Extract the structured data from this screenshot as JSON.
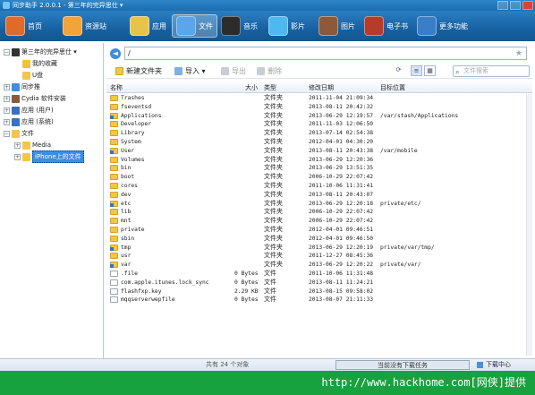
{
  "window": {
    "title": "同步助手 2.0.0.1 - 第三年的完异思仕 ▾"
  },
  "toolbar": {
    "items": [
      {
        "label": "首页",
        "icon": "home-icon",
        "color": "#e06a2a"
      },
      {
        "label": "资源站",
        "icon": "resource-icon",
        "color": "#f2a33a"
      },
      {
        "label": "应用",
        "icon": "apps-icon",
        "color": "#e6c44a"
      },
      {
        "label": "文件",
        "icon": "files-icon",
        "color": "#5aa6e8",
        "active": true
      },
      {
        "label": "音乐",
        "icon": "music-icon",
        "color": "#2c2c2c"
      },
      {
        "label": "影片",
        "icon": "video-icon",
        "color": "#4eb8f0"
      },
      {
        "label": "图片",
        "icon": "picture-icon",
        "color": "#8c5a3a"
      },
      {
        "label": "电子书",
        "icon": "ebook-icon",
        "color": "#b53c2a"
      },
      {
        "label": "更多功能",
        "icon": "more-icon",
        "color": "#3a7ec8"
      }
    ]
  },
  "sidebar": {
    "items": [
      {
        "label": "第三年的完异思仕 ▾",
        "icon": "phone-icon",
        "level": 0,
        "expander": "−",
        "color": "#333333"
      },
      {
        "label": "我的收藏",
        "icon": "star-icon",
        "level": 1,
        "expander": "",
        "color": "#f0c23a"
      },
      {
        "label": "U盘",
        "icon": "udisk-icon",
        "level": 1,
        "expander": "",
        "color": "#f3c54c"
      },
      {
        "label": "同步推",
        "icon": "tui-icon",
        "level": 0,
        "expander": "+",
        "color": "#3f8fe0"
      },
      {
        "label": "Cydia 软件安装",
        "icon": "cydia-icon",
        "level": 0,
        "expander": "+",
        "color": "#8a5a3a"
      },
      {
        "label": "应用 (用户)",
        "icon": "app-user-icon",
        "level": 0,
        "expander": "+",
        "color": "#3a6fc2"
      },
      {
        "label": "应用 (系统)",
        "icon": "app-system-icon",
        "level": 0,
        "expander": "+",
        "color": "#3a6fc2"
      },
      {
        "label": "文件",
        "icon": "folder-icon",
        "level": 0,
        "expander": "−",
        "color": "#f3c54c"
      },
      {
        "label": "Media",
        "icon": "folder-icon",
        "level": 1,
        "expander": "+",
        "color": "#f3c54c"
      },
      {
        "label": "iPhone上的文件",
        "icon": "folder-icon",
        "level": 1,
        "expander": "+",
        "color": "#f3c54c",
        "selected": true
      }
    ]
  },
  "pathbar": {
    "path": "/"
  },
  "actions": {
    "new_folder": "新建文件夹",
    "import": "导入 ▾",
    "export": "导出",
    "delete": "删除"
  },
  "search": {
    "placeholder": "文件搜索"
  },
  "columns": {
    "name": "名称",
    "size": "大小",
    "type": "类型",
    "modified": "修改日期",
    "target": "目标位置"
  },
  "files": [
    {
      "name": "Trashes",
      "size": "",
      "type": "文件夹",
      "date": "2011-11-04 21:09:34",
      "target": "",
      "kind": "folder"
    },
    {
      "name": "fseventsd",
      "size": "",
      "type": "文件夹",
      "date": "2013-08-11 20:42:32",
      "target": "",
      "kind": "folder"
    },
    {
      "name": "Applications",
      "size": "",
      "type": "文件夹",
      "date": "2013-06-29 12:19:57",
      "target": "/var/stash/Applications",
      "kind": "link"
    },
    {
      "name": "Developer",
      "size": "",
      "type": "文件夹",
      "date": "2011-11-03 12:06:50",
      "target": "",
      "kind": "folder"
    },
    {
      "name": "Library",
      "size": "",
      "type": "文件夹",
      "date": "2013-07-14 02:54:38",
      "target": "",
      "kind": "folder"
    },
    {
      "name": "System",
      "size": "",
      "type": "文件夹",
      "date": "2012-04-01 04:30:20",
      "target": "",
      "kind": "folder"
    },
    {
      "name": "User",
      "size": "",
      "type": "文件夹",
      "date": "2013-08-11 20:43:38",
      "target": "/var/mobile",
      "kind": "link"
    },
    {
      "name": "Volumes",
      "size": "",
      "type": "文件夹",
      "date": "2013-06-29 12:20:36",
      "target": "",
      "kind": "folder"
    },
    {
      "name": "bin",
      "size": "",
      "type": "文件夹",
      "date": "2013-06-29 13:51:35",
      "target": "",
      "kind": "folder"
    },
    {
      "name": "boot",
      "size": "",
      "type": "文件夹",
      "date": "2006-10-29 22:07:42",
      "target": "",
      "kind": "folder"
    },
    {
      "name": "cores",
      "size": "",
      "type": "文件夹",
      "date": "2011-10-06 11:31:41",
      "target": "",
      "kind": "folder"
    },
    {
      "name": "dev",
      "size": "",
      "type": "文件夹",
      "date": "2013-08-11 20:43:07",
      "target": "",
      "kind": "folder"
    },
    {
      "name": "etc",
      "size": "",
      "type": "文件夹",
      "date": "2013-06-29 12:20:18",
      "target": "private/etc/",
      "kind": "link"
    },
    {
      "name": "lib",
      "size": "",
      "type": "文件夹",
      "date": "2006-10-29 22:07:42",
      "target": "",
      "kind": "folder"
    },
    {
      "name": "mnt",
      "size": "",
      "type": "文件夹",
      "date": "2006-10-29 22:07:42",
      "target": "",
      "kind": "folder"
    },
    {
      "name": "private",
      "size": "",
      "type": "文件夹",
      "date": "2012-04-01 09:46:51",
      "target": "",
      "kind": "folder"
    },
    {
      "name": "sbin",
      "size": "",
      "type": "文件夹",
      "date": "2012-04-01 09:46:50",
      "target": "",
      "kind": "folder"
    },
    {
      "name": "tmp",
      "size": "",
      "type": "文件夹",
      "date": "2013-06-29 12:20:19",
      "target": "private/var/tmp/",
      "kind": "link"
    },
    {
      "name": "usr",
      "size": "",
      "type": "文件夹",
      "date": "2011-12-27 08:45:36",
      "target": "",
      "kind": "folder"
    },
    {
      "name": "var",
      "size": "",
      "type": "文件夹",
      "date": "2013-06-29 12:20:22",
      "target": "private/var/",
      "kind": "link"
    },
    {
      "name": ".file",
      "size": "0 Bytes",
      "type": "文件",
      "date": "2011-10-06 11:31:48",
      "target": "",
      "kind": "doc"
    },
    {
      "name": "com.apple.itunes.lock_sync",
      "size": "0 Bytes",
      "type": "文件",
      "date": "2013-08-11 11:24:21",
      "target": "",
      "kind": "doc"
    },
    {
      "name": "flashfxp.key",
      "size": "2.29 KB",
      "type": "文件",
      "date": "2013-08-15 09:58:02",
      "target": "",
      "kind": "doc"
    },
    {
      "name": "mqqserverwepfile",
      "size": "0 Bytes",
      "type": "文件",
      "date": "2013-08-07 21:11:33",
      "target": "",
      "kind": "doc"
    }
  ],
  "status": {
    "count": "共有 24 个对象",
    "download_task": "当前没有下载任务",
    "download_center": "下载中心"
  },
  "footer": {
    "watermark": "http://www.hackhome.com[网侠]提供"
  }
}
